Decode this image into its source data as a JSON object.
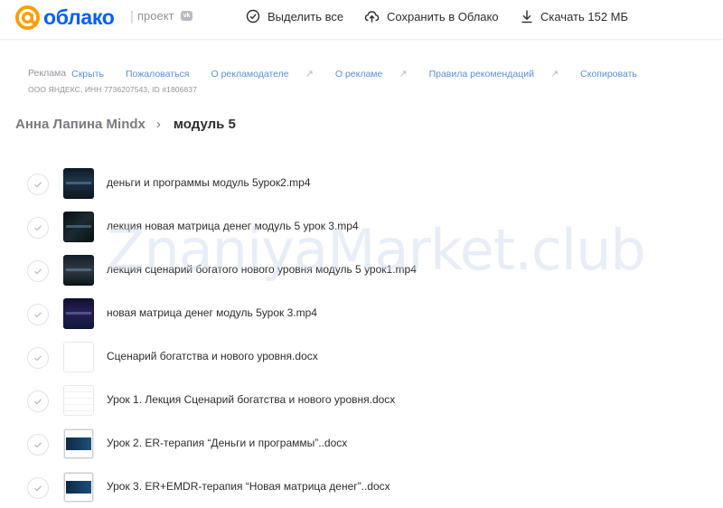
{
  "header": {
    "logo_text": "облако",
    "separator": "|",
    "project_label": "проект",
    "vk_badge": "vk",
    "select_all": "Выделить все",
    "save_to_cloud": "Сохранить в Облако",
    "download": "Скачать 152 МБ"
  },
  "ad": {
    "label": "Реклама",
    "links": [
      {
        "text": "Скрыть",
        "external": false
      },
      {
        "text": "Пожаловаться",
        "external": false
      },
      {
        "text": "О рекламодателе",
        "external": true
      },
      {
        "text": "О рекламе",
        "external": true
      },
      {
        "text": "Правила рекомендаций",
        "external": true
      },
      {
        "text": "Скопировать",
        "external": false
      }
    ],
    "external_arrow": "↗",
    "legal": "ООО ЯНДЕКС, ИНН 7736207543, ID #1806837"
  },
  "breadcrumb": {
    "parent": "Анна Лапина Mindx",
    "separator": "›",
    "current": "модуль 5"
  },
  "files": [
    {
      "name": "деньги и программы модуль 5урок2.mp4",
      "thumb": "video"
    },
    {
      "name": "лекция новая матрица денег модуль 5 урок 3.mp4",
      "thumb": "video"
    },
    {
      "name": "лекция сценарий богатого нового уровня модуль 5 урок1.mp4",
      "thumb": "video"
    },
    {
      "name": "новая матрица денег модуль 5урок 3.mp4",
      "thumb": "video"
    },
    {
      "name": "Сценарий богатства и нового уровня.docx",
      "thumb": "doc"
    },
    {
      "name": "Урок 1. Лекция Сценарий богатства и нового уровня.docx",
      "thumb": "doc"
    },
    {
      "name": "Урок 2. ER-терапия “Деньги и программы”..docx",
      "thumb": "video"
    },
    {
      "name": "Урок 3. ER+EMDR-терапия “Новая матрица денег”..docx",
      "thumb": "video"
    }
  ],
  "watermark": "ZnaniyaMarket.club",
  "colors": {
    "brand_blue": "#005ff9",
    "logo_orange": "#ff9e00",
    "link": "#5a8fd6",
    "text": "#2c2d2e",
    "muted": "#919399"
  }
}
